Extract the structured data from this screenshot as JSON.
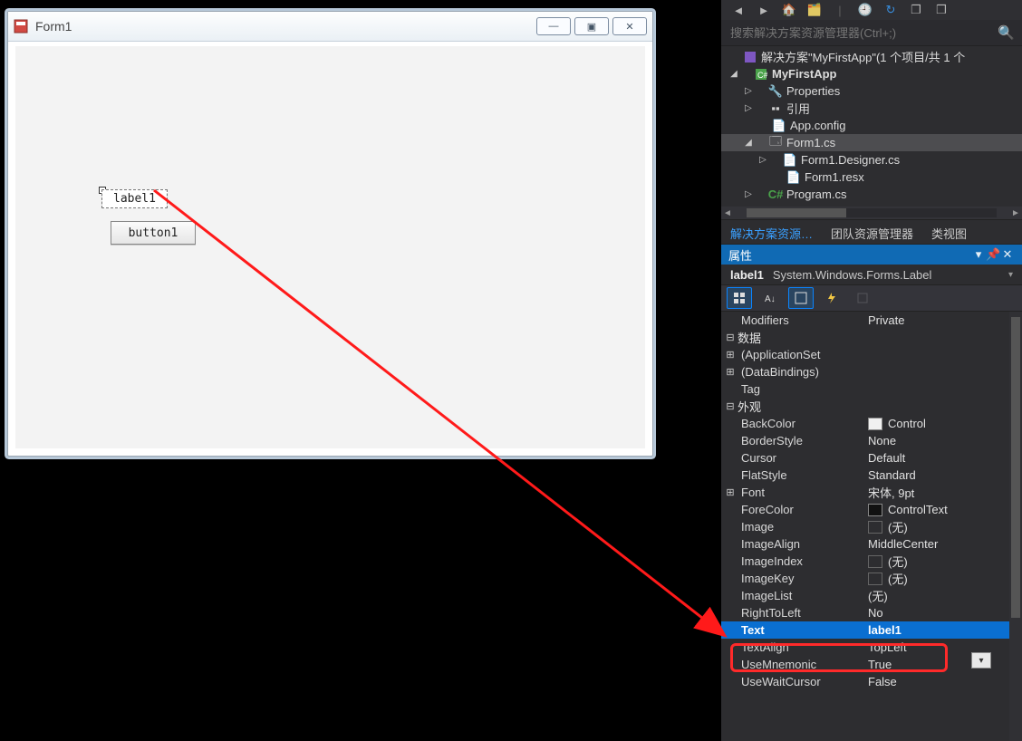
{
  "form": {
    "title": "Form1",
    "label_text": "label1",
    "button_text": "button1"
  },
  "search_placeholder": "搜索解决方案资源管理器(Ctrl+;)",
  "solution": {
    "root": "解决方案\"MyFirstApp\"(1 个项目/共 1 个",
    "project": "MyFirstApp",
    "nodes": {
      "properties": "Properties",
      "references": "引用",
      "appconfig": "App.config",
      "form1cs": "Form1.cs",
      "form1designer": "Form1.Designer.cs",
      "form1resx": "Form1.resx",
      "programcs": "Program.cs"
    }
  },
  "panel_tabs": {
    "solution": "解决方案资源…",
    "team": "团队资源管理器",
    "classview": "类视图"
  },
  "props": {
    "panel_title": "属性",
    "selected_name": "label1",
    "selected_type": "System.Windows.Forms.Label",
    "rows": {
      "Modifiers": "Private",
      "cat_data": "数据",
      "AppSettings": "(ApplicationSet",
      "DataBindings": "(DataBindings)",
      "Tag": "Tag",
      "cat_appearance": "外观",
      "BackColor": "Control",
      "BorderStyle": "None",
      "Cursor": "Default",
      "FlatStyle": "Standard",
      "Font": "宋体, 9pt",
      "ForeColor": "ControlText",
      "Image": "(无)",
      "ImageAlign": "MiddleCenter",
      "ImageIndex": "(无)",
      "ImageKey": "(无)",
      "ImageList": "(无)",
      "RightToLeft": "No",
      "Text": "label1",
      "TextAlign": "TopLeft",
      "UseMnemonic": "True",
      "UseWaitCursor": "False"
    },
    "keys": {
      "Modifiers": "Modifiers",
      "AppSettings": "(ApplicationSet",
      "DataBindings": "(DataBindings)",
      "Tag": "Tag",
      "BackColor": "BackColor",
      "BorderStyle": "BorderStyle",
      "Cursor": "Cursor",
      "FlatStyle": "FlatStyle",
      "Font": "Font",
      "ForeColor": "ForeColor",
      "Image": "Image",
      "ImageAlign": "ImageAlign",
      "ImageIndex": "ImageIndex",
      "ImageKey": "ImageKey",
      "ImageList": "ImageList",
      "RightToLeft": "RightToLeft",
      "Text": "Text",
      "TextAlign": "TextAlign",
      "UseMnemonic": "UseMnemonic",
      "UseWaitCursor": "UseWaitCursor"
    }
  }
}
